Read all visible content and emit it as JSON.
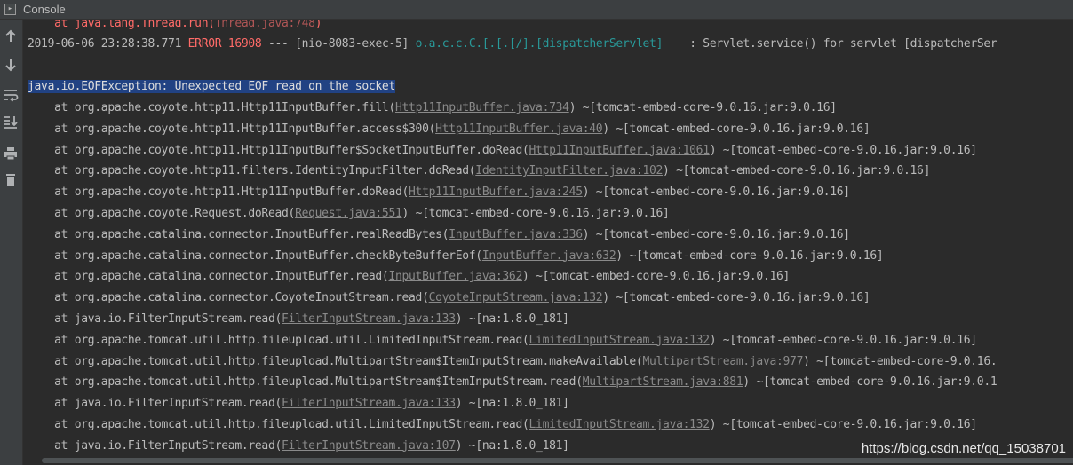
{
  "window": {
    "title": "Console",
    "title_icon": "console-icon",
    "accent_color": "#214283",
    "error_color": "#ff6b68"
  },
  "toolbar": {
    "buttons": [
      "up-arrow-icon",
      "down-arrow-icon",
      "soft-wrap-icon",
      "scroll-to-end-icon",
      "print-icon",
      "trash-icon"
    ]
  },
  "console": {
    "prev_trace": {
      "prefix": "at java.lang.Thread.run(",
      "link": "Thread.java:748",
      "suffix": ")"
    },
    "log_entry": {
      "timestamp": "2019-06-06 23:28:38.771",
      "level": "ERROR",
      "pid": "16908",
      "sep": "---",
      "thread": "[nio-8083-exec-5]",
      "logger": "o.a.c.c.C.[.[.[/].[dispatcherServlet]",
      "message": ": Servlet.service() for servlet [dispatcherSer"
    },
    "exception": "java.io.EOFException: Unexpected EOF read on the socket",
    "frames": [
      {
        "method": "at org.apache.coyote.http11.Http11InputBuffer.fill(",
        "link": "Http11InputBuffer.java:734",
        "jar": ") ~[tomcat-embed-core-9.0.16.jar:9.0.16]"
      },
      {
        "method": "at org.apache.coyote.http11.Http11InputBuffer.access$300(",
        "link": "Http11InputBuffer.java:40",
        "jar": ") ~[tomcat-embed-core-9.0.16.jar:9.0.16]"
      },
      {
        "method": "at org.apache.coyote.http11.Http11InputBuffer$SocketInputBuffer.doRead(",
        "link": "Http11InputBuffer.java:1061",
        "jar": ") ~[tomcat-embed-core-9.0.16.jar:9.0.16]"
      },
      {
        "method": "at org.apache.coyote.http11.filters.IdentityInputFilter.doRead(",
        "link": "IdentityInputFilter.java:102",
        "jar": ") ~[tomcat-embed-core-9.0.16.jar:9.0.16]"
      },
      {
        "method": "at org.apache.coyote.http11.Http11InputBuffer.doRead(",
        "link": "Http11InputBuffer.java:245",
        "jar": ") ~[tomcat-embed-core-9.0.16.jar:9.0.16]"
      },
      {
        "method": "at org.apache.coyote.Request.doRead(",
        "link": "Request.java:551",
        "jar": ") ~[tomcat-embed-core-9.0.16.jar:9.0.16]"
      },
      {
        "method": "at org.apache.catalina.connector.InputBuffer.realReadBytes(",
        "link": "InputBuffer.java:336",
        "jar": ") ~[tomcat-embed-core-9.0.16.jar:9.0.16]"
      },
      {
        "method": "at org.apache.catalina.connector.InputBuffer.checkByteBufferEof(",
        "link": "InputBuffer.java:632",
        "jar": ") ~[tomcat-embed-core-9.0.16.jar:9.0.16]"
      },
      {
        "method": "at org.apache.catalina.connector.InputBuffer.read(",
        "link": "InputBuffer.java:362",
        "jar": ") ~[tomcat-embed-core-9.0.16.jar:9.0.16]"
      },
      {
        "method": "at org.apache.catalina.connector.CoyoteInputStream.read(",
        "link": "CoyoteInputStream.java:132",
        "jar": ") ~[tomcat-embed-core-9.0.16.jar:9.0.16]"
      },
      {
        "method": "at java.io.FilterInputStream.read(",
        "link": "FilterInputStream.java:133",
        "jar": ") ~[na:1.8.0_181]"
      },
      {
        "method": "at org.apache.tomcat.util.http.fileupload.util.LimitedInputStream.read(",
        "link": "LimitedInputStream.java:132",
        "jar": ") ~[tomcat-embed-core-9.0.16.jar:9.0.16]"
      },
      {
        "method": "at org.apache.tomcat.util.http.fileupload.MultipartStream$ItemInputStream.makeAvailable(",
        "link": "MultipartStream.java:977",
        "jar": ") ~[tomcat-embed-core-9.0.16."
      },
      {
        "method": "at org.apache.tomcat.util.http.fileupload.MultipartStream$ItemInputStream.read(",
        "link": "MultipartStream.java:881",
        "jar": ") ~[tomcat-embed-core-9.0.16.jar:9.0.1"
      },
      {
        "method": "at java.io.FilterInputStream.read(",
        "link": "FilterInputStream.java:133",
        "jar": ") ~[na:1.8.0_181]"
      },
      {
        "method": "at org.apache.tomcat.util.http.fileupload.util.LimitedInputStream.read(",
        "link": "LimitedInputStream.java:132",
        "jar": ") ~[tomcat-embed-core-9.0.16.jar:9.0.16]"
      },
      {
        "method": "at java.io.FilterInputStream.read(",
        "link": "FilterInputStream.java:107",
        "jar": ") ~[na:1.8.0_181]"
      }
    ]
  },
  "watermark": "https://blog.csdn.net/qq_15038701"
}
